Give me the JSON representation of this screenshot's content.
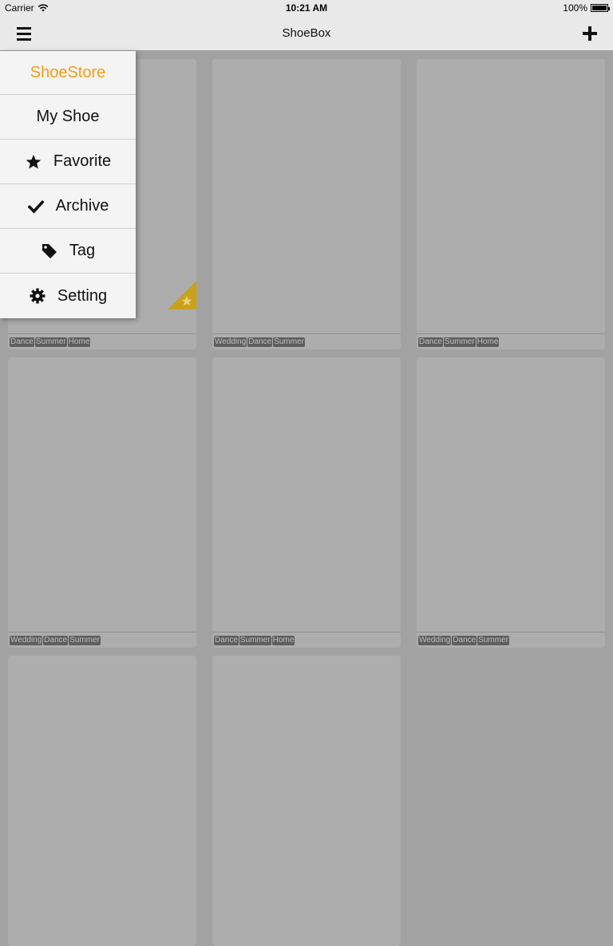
{
  "status_bar": {
    "carrier": "Carrier",
    "time": "10:21 AM",
    "battery": "100%"
  },
  "nav": {
    "title": "ShoeBox",
    "menu_icon": "hamburger-icon",
    "add_icon": "plus-icon"
  },
  "side_menu": {
    "brand": "ShoeStore",
    "brand_color": "#f39c12",
    "items": [
      {
        "label": "My Shoe",
        "icon": ""
      },
      {
        "label": "Favorite",
        "icon": "star-icon"
      },
      {
        "label": "Archive",
        "icon": "checkmark-icon"
      },
      {
        "label": "Tag",
        "icon": "tag-icon"
      },
      {
        "label": "Setting",
        "icon": "gear-icon"
      }
    ]
  },
  "cards": [
    {
      "tags": [
        "Dance",
        "Summer",
        "Home"
      ],
      "favorite": true
    },
    {
      "tags": [
        "Wedding",
        "Dance",
        "Summer"
      ],
      "favorite": false
    },
    {
      "tags": [
        "Dance",
        "Summer",
        "Home"
      ],
      "favorite": false
    },
    {
      "tags": [
        "Wedding",
        "Dance",
        "Summer"
      ],
      "favorite": false
    },
    {
      "tags": [
        "Dance",
        "Summer",
        "Home"
      ],
      "favorite": false
    },
    {
      "tags": [
        "Wedding",
        "Dance",
        "Summer"
      ],
      "favorite": false
    },
    {
      "tags": [],
      "favorite": false
    },
    {
      "tags": [],
      "favorite": false
    }
  ],
  "colors": {
    "favorite_badge": "#c9a21a",
    "overlay_dim": "#a2a2a2"
  }
}
